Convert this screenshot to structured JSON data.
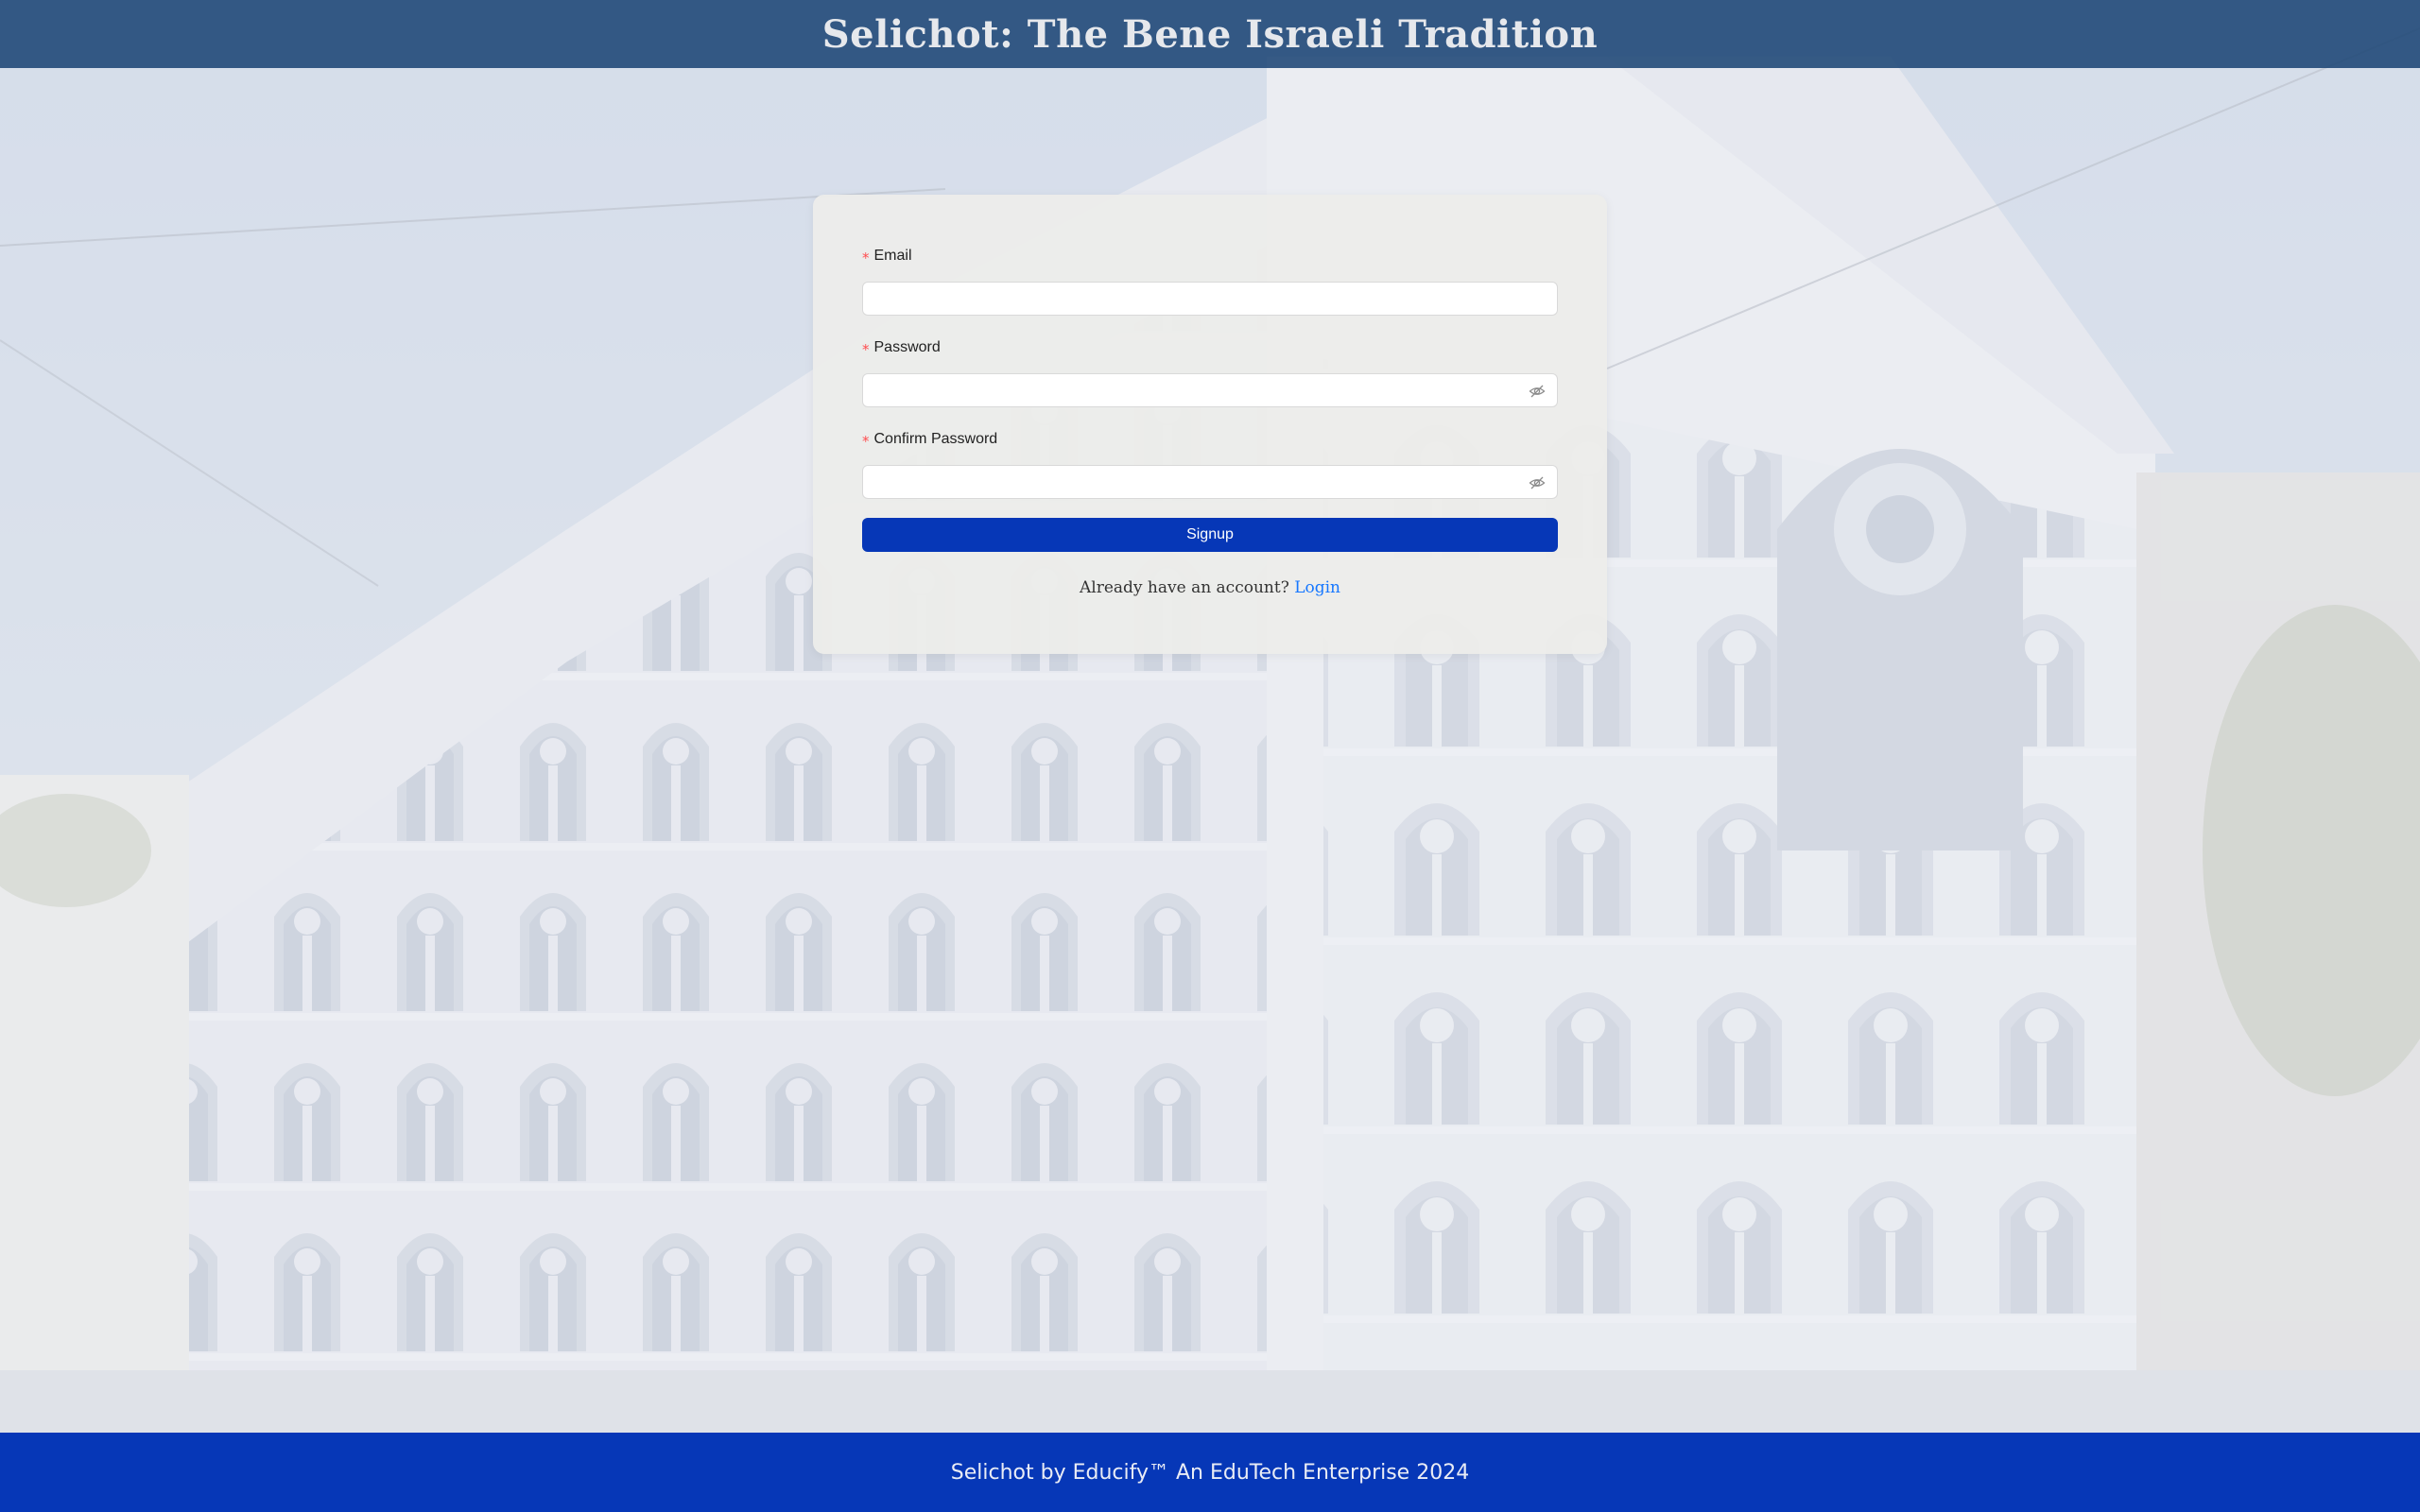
{
  "header": {
    "title": "Selichot: The Bene Israeli Tradition"
  },
  "form": {
    "email": {
      "label": "Email",
      "value": "",
      "required_mark": "*"
    },
    "password": {
      "label": "Password",
      "value": "",
      "required_mark": "*",
      "toggle_icon": "eye-invisible-icon"
    },
    "confirm_password": {
      "label": "Confirm Password",
      "value": "",
      "required_mark": "*",
      "toggle_icon": "eye-invisible-icon"
    },
    "submit_label": "Signup",
    "login_prompt": "Already have an account?",
    "login_link": "Login"
  },
  "footer": {
    "text": "Selichot by Educify™ An EduTech Enterprise 2024"
  },
  "colors": {
    "header_bg": "#1c4675",
    "primary": "#0637b7",
    "link": "#1677ff",
    "required": "#ff4d4f",
    "card_bg": "#ececea"
  },
  "background": {
    "icon": "synagogue-building-photo"
  }
}
